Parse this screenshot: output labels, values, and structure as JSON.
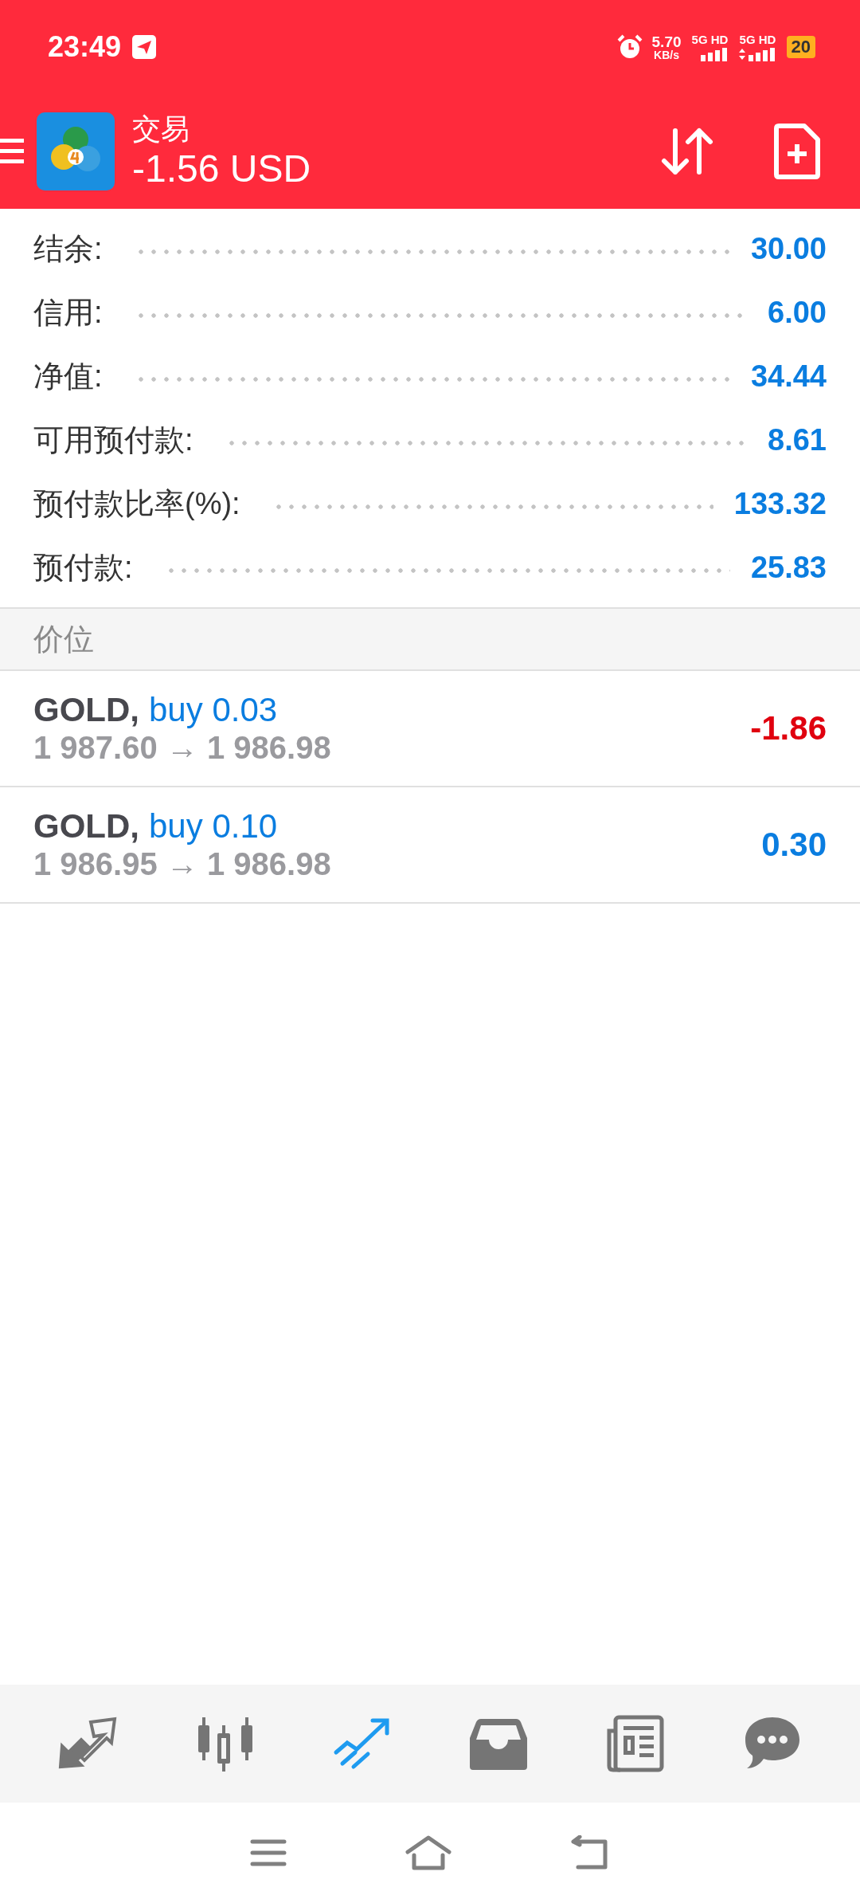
{
  "status_bar": {
    "time": "23:49",
    "speed": "5.70",
    "speed_unit": "KB/s",
    "sims": [
      "5G HD",
      "5G HD"
    ],
    "battery": "20"
  },
  "header": {
    "title": "交易",
    "balance": "-1.56 USD"
  },
  "summary": [
    {
      "label": "结余:",
      "value": "30.00"
    },
    {
      "label": "信用:",
      "value": "6.00"
    },
    {
      "label": "净值:",
      "value": "34.44"
    },
    {
      "label": "可用预付款:",
      "value": "8.61"
    },
    {
      "label": "预付款比率(%):",
      "value": "133.32"
    },
    {
      "label": "预付款:",
      "value": "25.83"
    }
  ],
  "section_title": "价位",
  "positions": [
    {
      "symbol": "GOLD,",
      "order": "buy 0.03",
      "prices": "1 987.60 → 1 986.98",
      "profit": "-1.86",
      "color": "#e0000f"
    },
    {
      "symbol": "GOLD,",
      "order": "buy 0.10",
      "prices": "1 986.95 → 1 986.98",
      "profit": "0.30",
      "color": "#0a7de0"
    }
  ],
  "bottom_nav": [
    {
      "kind": "quotes",
      "selected": false
    },
    {
      "kind": "chart",
      "selected": false
    },
    {
      "kind": "trade",
      "selected": true
    },
    {
      "kind": "inbox",
      "selected": false
    },
    {
      "kind": "news",
      "selected": false
    },
    {
      "kind": "chat",
      "selected": false
    }
  ]
}
